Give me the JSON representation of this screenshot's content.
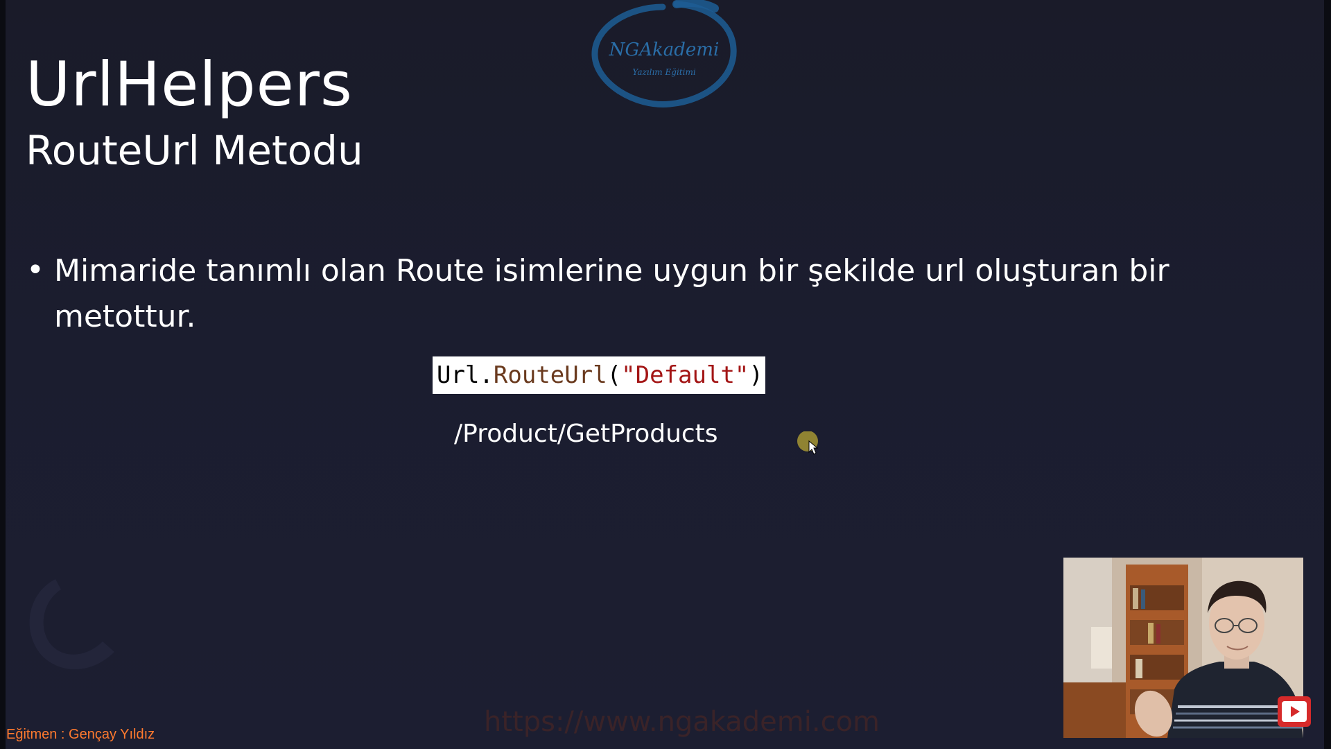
{
  "slide": {
    "title": "UrlHelpers",
    "subtitle": "RouteUrl Metodu",
    "logo": {
      "text": "NGAkademi",
      "tagline": "Yazılım Eğitimi",
      "color": "#1d5d94"
    },
    "bullet": {
      "marker": "•",
      "text": "Mimaride tanımlı olan Route isimlerine uygun bir şekilde url oluşturan bir metottur."
    },
    "code": {
      "object": "Url",
      "dot": ".",
      "method": "RouteUrl",
      "open_paren": "(",
      "argument": "\"Default\"",
      "close_paren": ")"
    },
    "result_path": "/Product/GetProducts",
    "watermark": "https://www.ngakademi.com",
    "instructor_label": "Eğitmen : Gençay Yıldız"
  },
  "icons": {
    "cursor": "mouse-pointer-icon",
    "logo": "ngakademi-logo-icon",
    "play": "youtube-play-icon",
    "decoration": "arc-decoration-icon"
  },
  "colors": {
    "background": "#1b1d2f",
    "text": "#ffffff",
    "code_string": "#a31515",
    "code_method": "#6a3a1e",
    "instructor_label": "#ff7a2e",
    "watermark": "#3a2328",
    "cursor_highlight": "#b8a634",
    "play_button": "#d62a2a"
  }
}
